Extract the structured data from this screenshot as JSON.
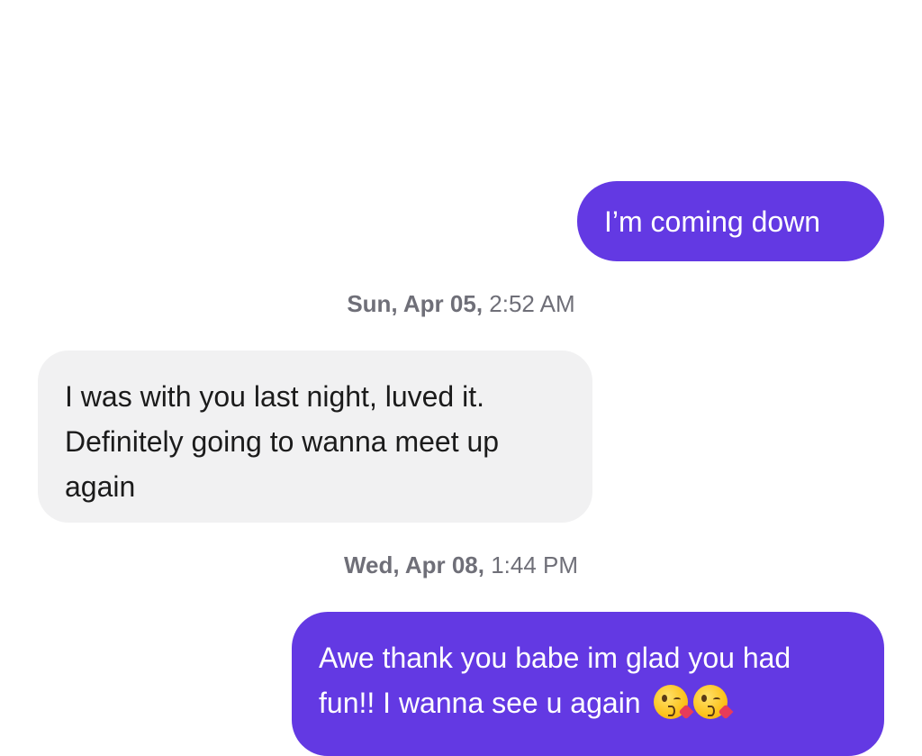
{
  "messages": [
    {
      "direction": "outgoing",
      "lines": [
        "I’m coming down"
      ]
    },
    {
      "direction": "incoming",
      "lines": [
        "I was with you last night, luved it.",
        "Definitely going to wanna meet up",
        "again"
      ]
    },
    {
      "direction": "outgoing",
      "lines": [
        "Awe thank you babe im glad you had",
        "fun!! I wanna see u again"
      ],
      "emojis": [
        "kissing-heart-emoji",
        "kissing-heart-emoji"
      ]
    }
  ],
  "timestamps": [
    {
      "date": "Sun, Apr 05,",
      "time": "2:52 AM"
    },
    {
      "date": "Wed, Apr 08,",
      "time": "1:44 PM"
    }
  ],
  "colors": {
    "outgoing_bubble": "#6339e3",
    "incoming_bubble": "#f1f1f2",
    "timestamp_text": "#6f6f78"
  }
}
